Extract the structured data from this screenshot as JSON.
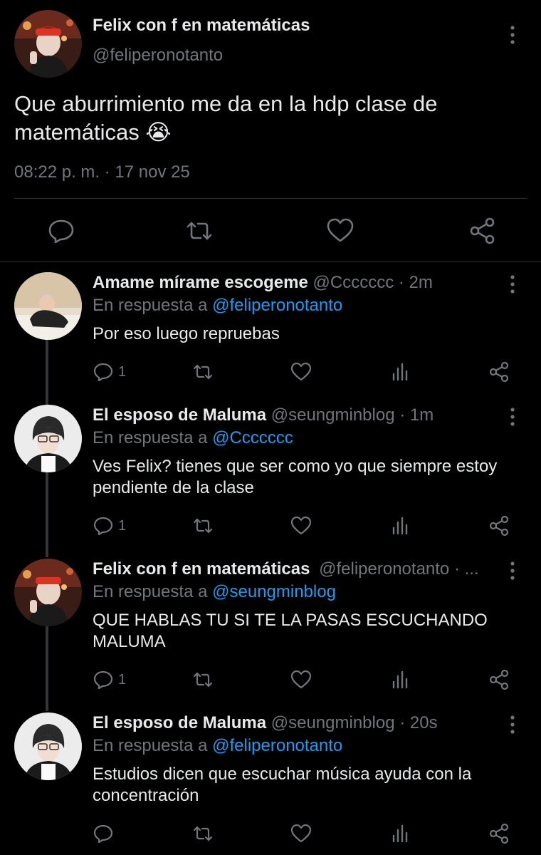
{
  "main_tweet": {
    "name": "Felix con f en matemáticas",
    "handle": "@feliperonotanto",
    "text": "Que aburrimiento me da en la hdp clase de matemáticas 😭",
    "timestamp": "08:22 p. m. · 17 nov 25",
    "actions": [
      "reply-icon",
      "retweet-icon",
      "like-icon",
      "share-icon"
    ]
  },
  "replies": [
    {
      "name": "Amame mírame escogeme",
      "handle": "@Ccccccc",
      "time_sep": " · ",
      "time": "2m",
      "reply_prefix": "En respuesta a ",
      "reply_to": "@feliperonotanto",
      "text": "Por eso luego repruebas",
      "reply_count": "1"
    },
    {
      "name": "El esposo de Maluma",
      "handle": "@seungminblog",
      "time_sep": " · ",
      "time": "1m",
      "reply_prefix": "En respuesta a ",
      "reply_to": "@Ccccccc",
      "text": "Ves Felix? tienes que ser como yo que siempre estoy pendiente de la clase",
      "reply_count": "1"
    },
    {
      "name": "Felix con f en matemáticas",
      "handle": "@feliperonotanto",
      "time_sep": " · ",
      "time": "...",
      "reply_prefix": "En respuesta a ",
      "reply_to": "@seungminblog",
      "text": "QUE HABLAS TU SI TE LA PASAS ESCUCHANDO MALUMA",
      "reply_count": "1"
    },
    {
      "name": "El esposo de Maluma",
      "handle": "@seungminblog",
      "time_sep": " · ",
      "time": "20s",
      "reply_prefix": "En respuesta a ",
      "reply_to": "@feliperonotanto",
      "text": "Estudios dicen que escuchar música ayuda con la concentración",
      "reply_count": ""
    }
  ],
  "colors": {
    "background": "#000000",
    "text": "#e7e9ea",
    "secondary": "#71767b",
    "link": "#1d9bf0",
    "divider": "#2f3336"
  }
}
